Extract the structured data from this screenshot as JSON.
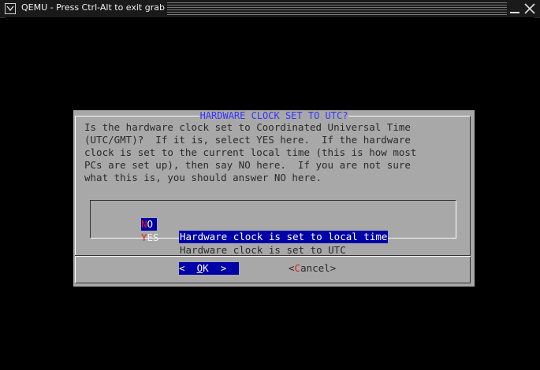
{
  "window": {
    "title": "QEMU - Press Ctrl-Alt to exit grab"
  },
  "dialog": {
    "title": "HARDWARE CLOCK SET TO UTC?",
    "body_lines": [
      "Is the hardware clock set to Coordinated Universal Time",
      "(UTC/GMT)?  If it is, select YES here.  If the hardware",
      "clock is set to the current local time (this is how most",
      "PCs are set up), then say NO here.  If you are not sure",
      "what this is, you should answer NO here."
    ],
    "menu": [
      {
        "tag_hotkey": "N",
        "tag_rest": "O",
        "description": "Hardware clock is set to local time",
        "selected": true
      },
      {
        "tag_hotkey": "Y",
        "tag_rest": "ES",
        "description": "Hardware clock is set to UTC",
        "selected": false
      }
    ],
    "buttons": {
      "ok": {
        "left": "<  ",
        "hotkey": "O",
        "rest": "K",
        "right": "  >"
      },
      "cancel": {
        "left": "<",
        "hotkey": "C",
        "rest": "ancel",
        "right": ">"
      }
    }
  },
  "colors": {
    "dialog_bg": "#a8a8a8",
    "selection": "#0000a8",
    "title_fg": "#3434ff",
    "hotkey": "#e02020"
  }
}
